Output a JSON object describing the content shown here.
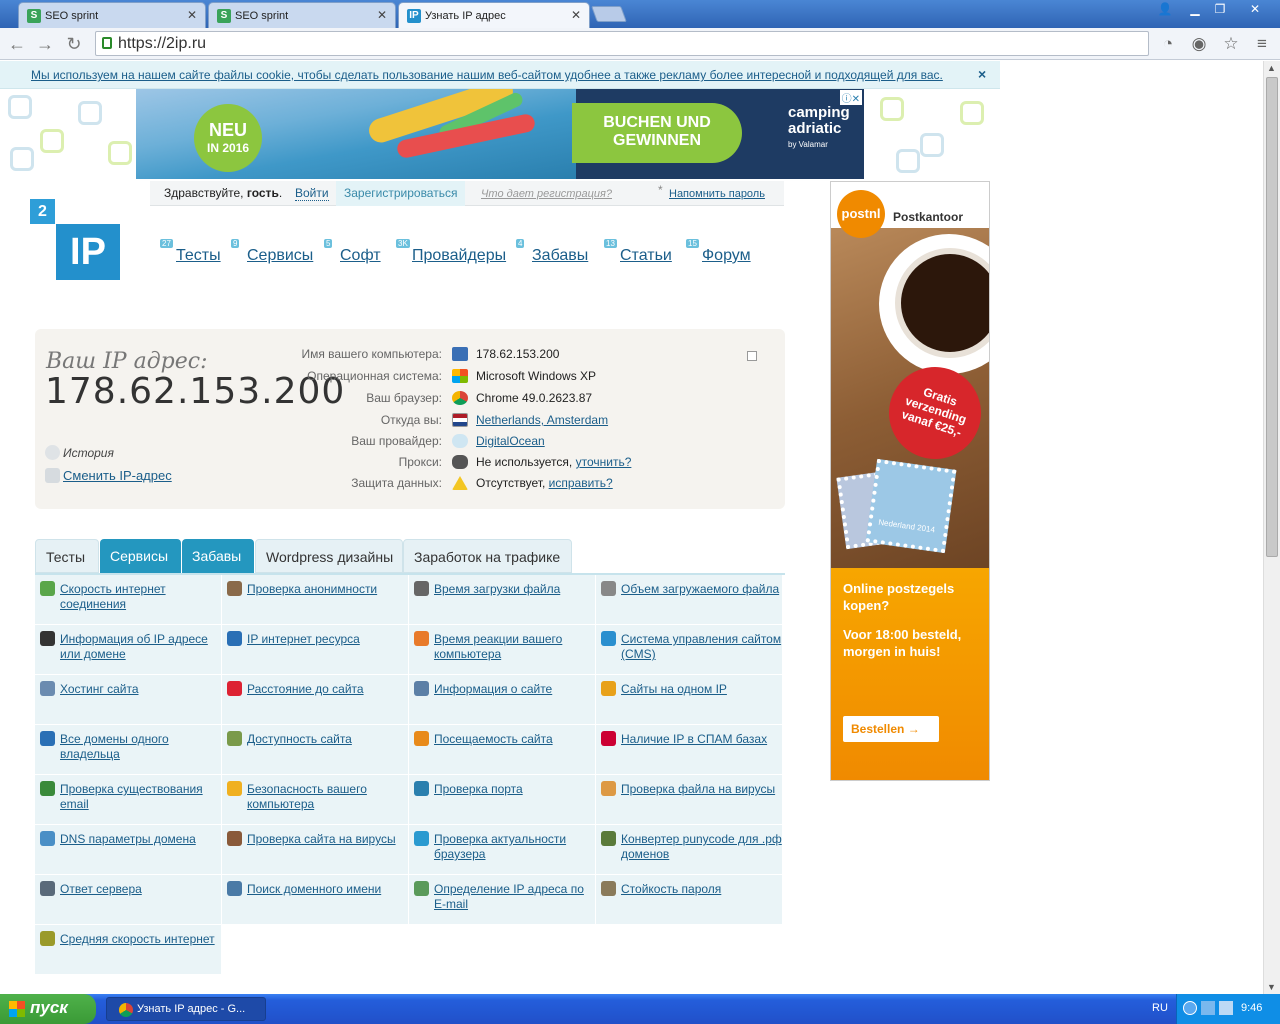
{
  "browser": {
    "tabs": [
      {
        "title": "SEO sprint",
        "active": false
      },
      {
        "title": "SEO sprint",
        "active": false
      },
      {
        "title": "Узнать IP адрес",
        "active": true
      }
    ],
    "url": "https://2ip.ru"
  },
  "cookie_bar": {
    "text": "Мы используем на нашем сайте файлы cookie, чтобы сделать пользование нашим веб-сайтом удобнее а также рекламу более интересной и подходящей для вас.",
    "close": "×"
  },
  "top_ad": {
    "badge_line1": "NEU",
    "badge_line2": "IN 2016",
    "cta": "BUCHEN UND GEWINNEN",
    "brand": "camping adriatic",
    "brand_sub": "by Valamar"
  },
  "login": {
    "greeting": "Здравствуйте,",
    "guest": "гость",
    "login_link": "Войти",
    "register": "Зарегистрироваться",
    "why": "Что дает регистрация?",
    "star": "*",
    "remind": "Напомнить пароль"
  },
  "logo": {
    "small": "2",
    "big": "IP"
  },
  "nav": [
    {
      "label": "Тесты",
      "count": "27"
    },
    {
      "label": "Сервисы",
      "count": "9"
    },
    {
      "label": "Софт",
      "count": "5"
    },
    {
      "label": "Провайдеры",
      "count": "3K"
    },
    {
      "label": "Забавы",
      "count": "4"
    },
    {
      "label": "Статьи",
      "count": "13"
    },
    {
      "label": "Форум",
      "count": "15"
    }
  ],
  "ip_info": {
    "label": "Ваш IP адрес:",
    "ip": "178.62.153.200",
    "history": "История",
    "change": "Сменить IP-адрес",
    "rows": [
      {
        "key": "Имя вашего компьютера:",
        "value": "178.62.153.200",
        "link": false,
        "extra": "",
        "icon": "computer-icon"
      },
      {
        "key": "Операционная система:",
        "value": "Microsoft Windows XP",
        "link": false,
        "extra": "",
        "icon": "windows-icon"
      },
      {
        "key": "Ваш браузер:",
        "value": "Chrome 49.0.2623.87",
        "link": false,
        "extra": "",
        "icon": "chrome-icon"
      },
      {
        "key": "Откуда вы:",
        "value": "Netherlands, Amsterdam",
        "link": true,
        "extra": "",
        "icon": "netherlands-flag-icon"
      },
      {
        "key": "Ваш провайдер:",
        "value": "DigitalOcean",
        "link": true,
        "extra": "",
        "icon": "cloud-icon"
      },
      {
        "key": "Прокси:",
        "value": "Не используется,",
        "link": false,
        "extra": "уточнить?",
        "icon": "spy-glasses-icon"
      },
      {
        "key": "Защита данных:",
        "value": "Отсутствует,",
        "link": false,
        "extra": "исправить?",
        "icon": "warning-icon"
      }
    ]
  },
  "section_tabs": [
    "Тесты",
    "Сервисы",
    "Забавы",
    "Wordpress дизайны",
    "Заработок на трафике"
  ],
  "services": [
    [
      "Скорость интернет соединения",
      "Проверка анонимности",
      "Время загрузки файла",
      "Объем загружаемого файла"
    ],
    [
      "Информация об IP адресе или домене",
      "IP интернет ресурса",
      "Время реакции вашего компьютера",
      "Система управления сайтом (CMS)"
    ],
    [
      "Хостинг сайта",
      "Расстояние до сайта",
      "Информация о сайте",
      "Сайты на одном IP"
    ],
    [
      "Все домены одного владельца",
      "Доступность сайта",
      "Посещаемость сайта",
      "Наличие IP в СПАМ базах"
    ],
    [
      "Проверка существования email",
      "Безопасность вашего компьютера",
      "Проверка порта",
      "Проверка файла на вирусы"
    ],
    [
      "DNS параметры домена",
      "Проверка сайта на вирусы",
      "Проверка актуальности браузера",
      "Конвертер punycode для .рф доменов"
    ],
    [
      "Ответ сервера",
      "Поиск доменного имени",
      "Определение IP адреса по E-mail",
      "Стойкость пароля"
    ],
    [
      "Средняя скорость интернет"
    ]
  ],
  "side_ad": {
    "brand": "postnl",
    "office": "Postkantoor",
    "promo": "Gratis verzending vanaf €25,-",
    "question": "Online postzegels kopen?",
    "detail": "Voor 18:00 besteld, morgen in huis!",
    "button": "Bestellen →",
    "stamp_text": "Nederland 2014"
  },
  "taskbar": {
    "start": "пуск",
    "task": "Узнать IP адрес - G...",
    "lang": "RU",
    "time": "9:46"
  }
}
